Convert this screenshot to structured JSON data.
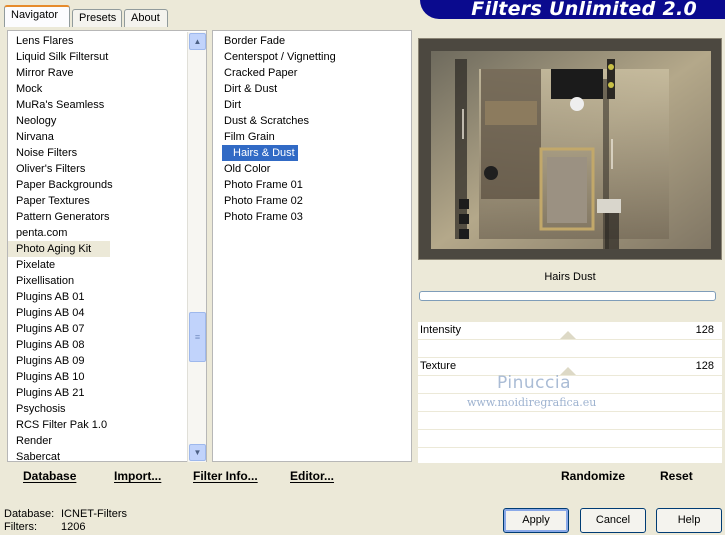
{
  "tabs": [
    {
      "label": "Navigator",
      "active": true
    },
    {
      "label": "Presets",
      "active": false
    },
    {
      "label": "About",
      "active": false
    }
  ],
  "banner": {
    "title": "Filters Unlimited 2.0"
  },
  "categories": {
    "items": [
      "Lens Flares",
      "Liquid Silk Filtersut",
      "Mirror Rave",
      "Mock",
      "MuRa's Seamless",
      "Neology",
      "Nirvana",
      "Noise Filters",
      "Oliver's Filters",
      "Paper Backgrounds",
      "Paper Textures",
      "Pattern Generators",
      "penta.com",
      "Photo Aging Kit",
      "Pixelate",
      "Pixellisation",
      "Plugins AB 01",
      "Plugins AB 04",
      "Plugins AB 07",
      "Plugins AB 08",
      "Plugins AB 09",
      "Plugins AB 10",
      "Plugins AB 21",
      "Psychosis",
      "RCS Filter Pak 1.0",
      "Render",
      "Sabercat"
    ],
    "selected": "Photo Aging Kit"
  },
  "filters": {
    "items": [
      "Border Fade",
      "Centerspot / Vignetting",
      "Cracked Paper",
      "Dirt & Dust",
      "Dirt",
      "Dust & Scratches",
      "Film Grain",
      "Hairs & Dust",
      "Old Color",
      "Photo Frame 01",
      "Photo Frame 02",
      "Photo Frame 03"
    ],
    "selected": "Hairs & Dust"
  },
  "commands": {
    "database": "Database",
    "import": "Import...",
    "filter_info": "Filter Info...",
    "editor": "Editor...",
    "randomize": "Randomize",
    "reset": "Reset"
  },
  "preview": {
    "filter_name": "Hairs  Dust",
    "params": [
      {
        "label": "Intensity",
        "value": "128"
      },
      {
        "label": "Texture",
        "value": "128"
      }
    ],
    "progress": 0
  },
  "watermark": {
    "line1": "Pinuccia",
    "line2": "www.moidiregrafica.eu"
  },
  "status": {
    "database_label": "Database:",
    "database_value": "ICNET-Filters",
    "filters_label": "Filters:",
    "filters_value": "1206"
  },
  "buttons": {
    "apply": "Apply",
    "cancel": "Cancel",
    "help": "Help"
  },
  "colors": {
    "banner": "#0a0a8e",
    "selection": "#316ac5",
    "active_tab_accent": "#e68b2c"
  },
  "icons": [
    "scroll-up-icon",
    "scroll-down-icon",
    "scroll-grip-icon"
  ]
}
